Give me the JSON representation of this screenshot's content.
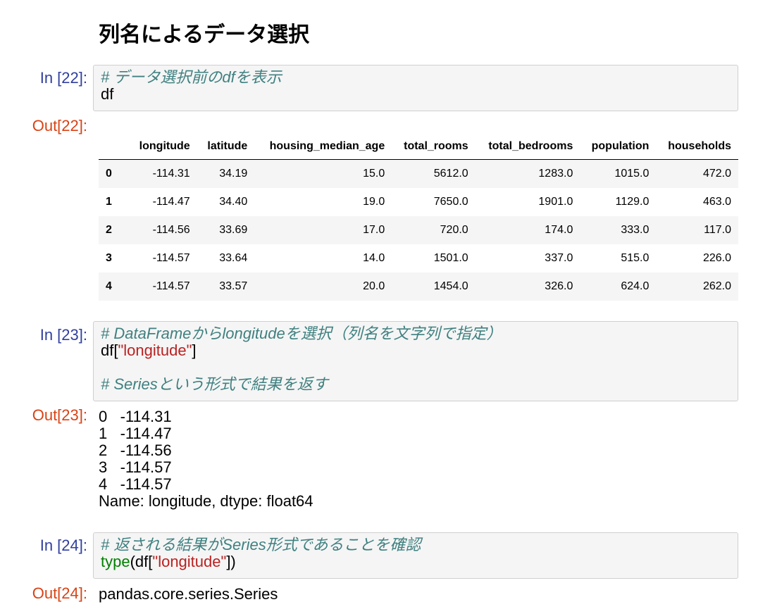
{
  "heading": "列名によるデータ選択",
  "cells": [
    {
      "in_prompt": "In [22]:",
      "lines": [
        {
          "comment": "# データ選択前のdfを表示"
        },
        {
          "code": "df"
        }
      ],
      "out_prompt": "Out[22]:"
    },
    {
      "in_prompt": "In [23]:",
      "lines": [
        {
          "comment": "# DataFrameからlongitudeを選択（列名を文字列で指定）"
        },
        {
          "code_pre": "df[",
          "string": "\"longitude\"",
          "code_post": "]"
        },
        {
          "blank": ""
        },
        {
          "comment": "# Seriesという形式で結果を返す"
        }
      ],
      "out_prompt": "Out[23]:",
      "output_lines": [
        "0   -114.31",
        "1   -114.47",
        "2   -114.56",
        "3   -114.57",
        "4   -114.57",
        "Name: longitude, dtype: float64"
      ]
    },
    {
      "in_prompt": "In [24]:",
      "lines": [
        {
          "comment": "# 返される結果がSeries形式であることを確認"
        },
        {
          "builtin": "type",
          "code_pre": "(df[",
          "string": "\"longitude\"",
          "code_post": "])"
        }
      ],
      "out_prompt": "Out[24]:",
      "output_lines": [
        "pandas.core.series.Series"
      ]
    }
  ],
  "dataframe": {
    "columns": [
      "longitude",
      "latitude",
      "housing_median_age",
      "total_rooms",
      "total_bedrooms",
      "population",
      "households"
    ],
    "rows": [
      {
        "index": "0",
        "values": [
          "-114.31",
          "34.19",
          "15.0",
          "5612.0",
          "1283.0",
          "1015.0",
          "472.0"
        ]
      },
      {
        "index": "1",
        "values": [
          "-114.47",
          "34.40",
          "19.0",
          "7650.0",
          "1901.0",
          "1129.0",
          "463.0"
        ]
      },
      {
        "index": "2",
        "values": [
          "-114.56",
          "33.69",
          "17.0",
          "720.0",
          "174.0",
          "333.0",
          "117.0"
        ]
      },
      {
        "index": "3",
        "values": [
          "-114.57",
          "33.64",
          "14.0",
          "1501.0",
          "337.0",
          "515.0",
          "226.0"
        ]
      },
      {
        "index": "4",
        "values": [
          "-114.57",
          "33.57",
          "20.0",
          "1454.0",
          "326.0",
          "624.0",
          "262.0"
        ]
      }
    ]
  },
  "colors": {
    "in_prompt": "#303f9f",
    "out_prompt": "#d84315",
    "comment": "#408080",
    "string": "#ba2121",
    "builtin": "#008000"
  }
}
